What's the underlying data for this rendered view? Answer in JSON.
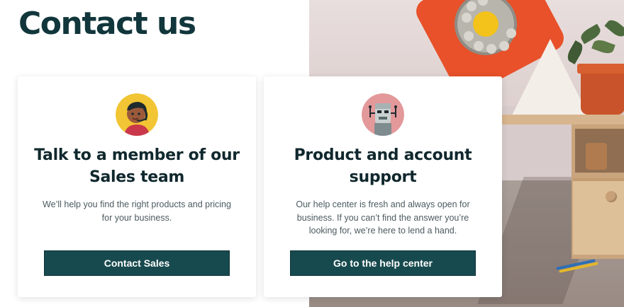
{
  "page": {
    "title": "Contact us"
  },
  "cards": [
    {
      "heading": "Talk to a member of our Sales team",
      "description": "We’ll help you find the right products and pricing for your business.",
      "button_label": "Contact Sales",
      "avatar_icon": "headset-agent-avatar-icon"
    },
    {
      "heading": "Product and account support",
      "description": "Our help center is fresh and always open for business. If you can’t find the answer you’re looking for, we’re here to lend a hand.",
      "button_label": "Go to the help center",
      "avatar_icon": "robot-avatar-icon"
    }
  ],
  "colors": {
    "title": "#11363b",
    "button_bg": "#174a4e",
    "button_text": "#ffffff"
  }
}
